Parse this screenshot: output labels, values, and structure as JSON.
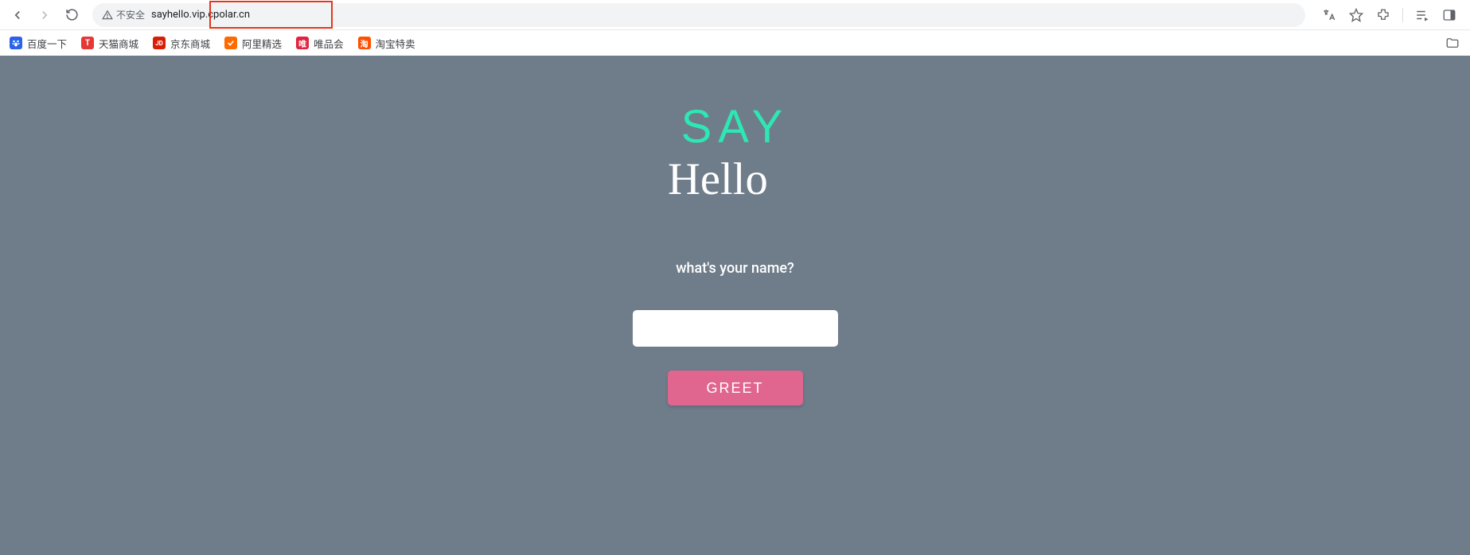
{
  "browser": {
    "security_label": "不安全",
    "url": "sayhello.vip.cpolar.cn"
  },
  "bookmarks": {
    "items": [
      {
        "label": "百度一下"
      },
      {
        "label": "天猫商城"
      },
      {
        "label": "京东商城"
      },
      {
        "label": "阿里精选"
      },
      {
        "label": "唯品会"
      },
      {
        "label": "淘宝特卖"
      }
    ]
  },
  "page": {
    "title_top": "SAY",
    "title_bottom": "Hello",
    "prompt": "what's your name?",
    "input_value": "",
    "greet_label": "GREET"
  },
  "colors": {
    "page_bg": "#6f7c8a",
    "accent_mint": "#2de7b4",
    "button_pink": "#e06690",
    "highlight_border": "#e3361b"
  }
}
